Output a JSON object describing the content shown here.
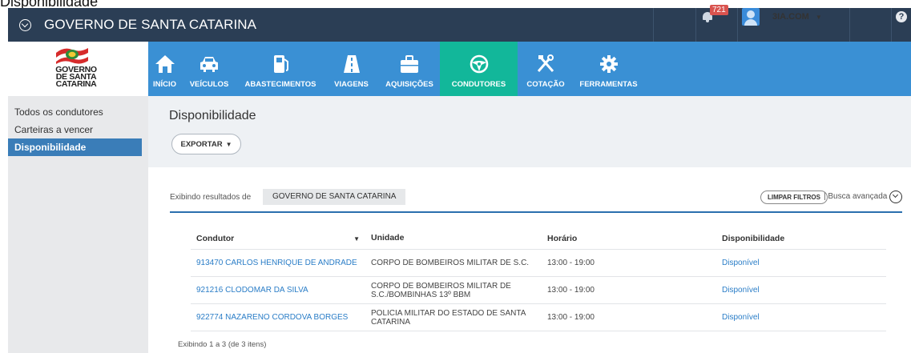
{
  "window": {
    "title": "Disponibilidade"
  },
  "topbar": {
    "brand": "GOVERNO DE SANTA CATARINA",
    "notification_count": "721",
    "user_name": "3IA.COM",
    "user_caret": "▼",
    "help": "?"
  },
  "logo": {
    "line1": "GOVERNO",
    "line2": "DE SANTA",
    "line3": "CATARINA"
  },
  "nav": {
    "items": [
      {
        "label": "INÍCIO",
        "icon": "home-icon"
      },
      {
        "label": "VEÍCULOS",
        "icon": "car-icon"
      },
      {
        "label": "ABASTECIMENTOS",
        "icon": "fuel-pump-icon"
      },
      {
        "label": "VIAGENS",
        "icon": "road-icon"
      },
      {
        "label": "AQUISIÇÕES",
        "icon": "briefcase-icon"
      },
      {
        "label": "CONDUTORES",
        "icon": "steering-wheel-icon",
        "active": true
      },
      {
        "label": "COTAÇÃO",
        "icon": "tools-icon"
      },
      {
        "label": "FERRAMENTAS",
        "icon": "gear-icon"
      }
    ],
    "colors": {
      "bar": "#3a90d4",
      "active": "#12b79a"
    }
  },
  "sidebar": {
    "items": [
      {
        "label": "Todos os condutores"
      },
      {
        "label": "Carteiras a vencer"
      },
      {
        "label": "Disponibilidade",
        "active": true
      }
    ]
  },
  "header": {
    "title": "Disponibilidade",
    "export_label": "EXPORTAR",
    "export_caret": "▼"
  },
  "filters": {
    "label": "Exibindo resultados de",
    "chip": "GOVERNO DE SANTA CATARINA",
    "clear_label": "LIMPAR FILTROS",
    "advanced_label": "| Busca avançada"
  },
  "table": {
    "columns": [
      "Condutor",
      "Unidade",
      "Horário",
      "Disponibilidade"
    ],
    "sort_indicator": "▼",
    "rows": [
      {
        "condutor": "913470 CARLOS HENRIQUE DE ANDRADE",
        "unidade": "CORPO DE BOMBEIROS MILITAR DE S.C.",
        "horario": "13:00 - 19:00",
        "disponibilidade": "Disponível"
      },
      {
        "condutor": "921216 CLODOMAR DA SILVA",
        "unidade": "CORPO DE BOMBEIROS MILITAR DE S.C./BOMBINHAS 13º BBM",
        "horario": "13:00 - 19:00",
        "disponibilidade": "Disponível"
      },
      {
        "condutor": "922774 NAZARENO CORDOVA BORGES",
        "unidade": "POLICIA MILITAR DO ESTADO DE SANTA CATARINA",
        "horario": "13:00 - 19:00",
        "disponibilidade": "Disponível"
      }
    ],
    "footer": "Exibindo 1 a 3 (de 3 itens)"
  }
}
